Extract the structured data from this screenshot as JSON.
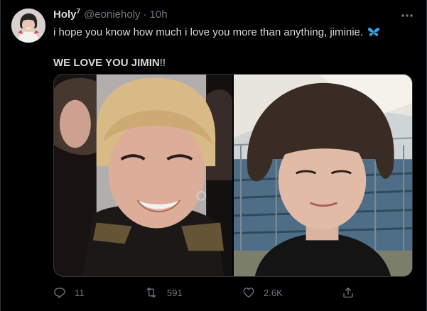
{
  "tweet": {
    "display_name": "Holy",
    "name_superscript": "7",
    "handle": "@eonieholy",
    "separator": "·",
    "time": "10h",
    "text_line1": "i hope you know how much i love you more than anything, jiminie.",
    "text_line2_bold": "WE LOVE YOU JIMIN",
    "text_line2_suffix": "!!"
  },
  "icons": {
    "more": "more-horizontal-icon",
    "butterfly": "butterfly-emoji",
    "reply": "reply-icon",
    "retweet": "retweet-icon",
    "like": "heart-icon",
    "share": "share-icon"
  },
  "actions": {
    "reply_count": "11",
    "retweet_count": "591",
    "like_count": "2.6K"
  },
  "colors": {
    "background": "#000000",
    "text_primary": "#d9d9d9",
    "text_secondary": "#6e767d",
    "border": "#2f3336",
    "emoji_blue": "#3ba1e8"
  }
}
